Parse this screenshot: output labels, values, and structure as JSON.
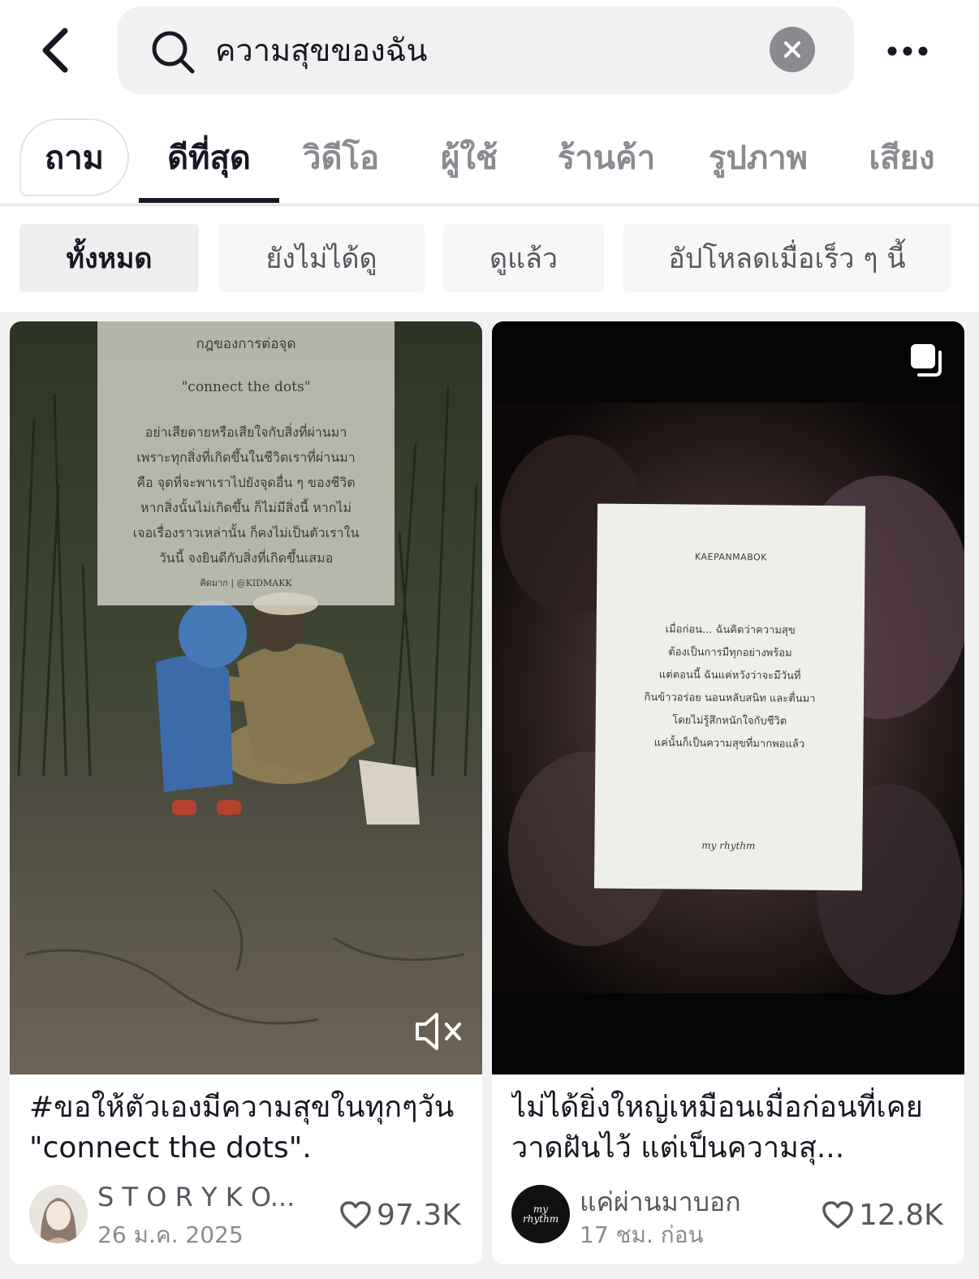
{
  "search": {
    "query": "ความสุขของฉัน"
  },
  "tabs": {
    "ask": "ถาม",
    "items": [
      "ดีที่สุด",
      "วิดีโอ",
      "ผู้ใช้",
      "ร้านค้า",
      "รูปภาพ",
      "เสียง"
    ],
    "active": "ดีที่สุด"
  },
  "filters": {
    "items": [
      "ทั้งหมด",
      "ยังไม่ได้ดู",
      "ดูแล้ว",
      "อัปโหลดเมื่อเร็ว ๆ นี้"
    ],
    "active": "ทั้งหมด"
  },
  "cards": [
    {
      "overlay": {
        "heading": "กฎของการต่อจุด",
        "subheading": "\"connect the dots\"",
        "lines": [
          "อย่าเสียดายหรือเสียใจกับสิ่งที่ผ่านมา",
          "เพราะทุกสิ่งที่เกิดขึ้นในชีวิตเราที่ผ่านมา",
          "คือ จุดที่จะพาเราไปยังจุดอื่น ๆ ของชีวิต",
          "หากสิ่งนั้นไม่เกิดขึ้น ก็ไม่มีสิ่งนี้ หากไม่",
          "เจอเรื่องราวเหล่านั้น ก็คงไม่เป็นตัวเราใน",
          "วันนี้ จงยินดีกับสิ่งที่เกิดขึ้นเสมอ"
        ],
        "credit": "คิดมาก | @KIDMAKK"
      },
      "muted_icon": "speaker-muted-icon",
      "title": "#ขอให้ตัวเองมีความสุขในทุกๆวัน \"connect the dots\".",
      "author": "S T O R Y K O...",
      "date": "26 ม.ค. 2025",
      "likes": "97.3K"
    },
    {
      "overlay": {
        "heading": "KAEPANMABOK",
        "lines": [
          "เมื่อก่อน... ฉันคิดว่าความสุข",
          "ต้องเป็นการมีทุกอย่างพร้อม",
          "แต่ตอนนี้ ฉันแค่หวังว่าจะมีวันที่",
          "กินข้าวอร่อย นอนหลับสนิท และตื่นมา",
          "โดยไม่รู้สึกหนักใจกับชีวิต",
          "แค่นั้นก็เป็นความสุขที่มากพอแล้ว"
        ],
        "signature": "my rhythm"
      },
      "multi_icon": "photo-carousel-icon",
      "title": "ไม่ได้ยิ่งใหญ่เหมือนเมื่อก่อนที่เคยวาดฝันไว้ แต่เป็นความสุ...",
      "avatar_text": "my rhythm",
      "author": "แค่ผ่านมาบอก",
      "date": "17 ชม. ก่อน",
      "likes": "12.8K"
    }
  ]
}
